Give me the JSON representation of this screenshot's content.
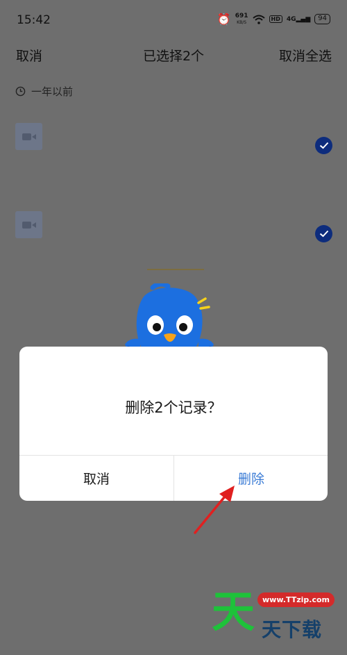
{
  "status_bar": {
    "time": "15:42",
    "net_speed": "691",
    "net_unit": "KB/S",
    "hd": "HD",
    "signal": "4G",
    "battery": "94"
  },
  "top_bar": {
    "cancel": "取消",
    "title": "已选择2个",
    "select_all": "取消全选"
  },
  "section": {
    "label": "一年以前"
  },
  "records": [
    {
      "type": "video-icon",
      "selected": true
    },
    {
      "type": "video-icon",
      "selected": true
    }
  ],
  "dialog": {
    "message": "删除2个记录？",
    "cancel": "取消",
    "delete": "删除"
  },
  "watermark": {
    "big": "天",
    "url": "www.TTzip.com",
    "small": "天下载"
  },
  "colors": {
    "overlay": "#6e6e6e",
    "check": "#0d2c7d",
    "delete_text": "#3a7bd5",
    "arrow": "#e02020",
    "mascot": "#1c6fe0"
  }
}
